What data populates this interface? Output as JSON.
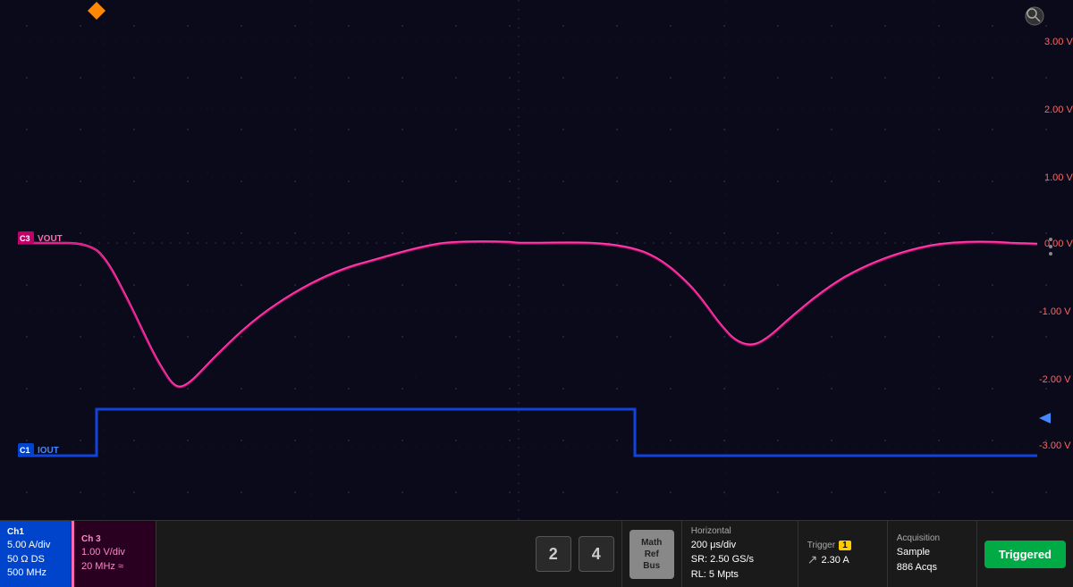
{
  "screen": {
    "y_labels": [
      {
        "value": "3.00 V",
        "pct": 8
      },
      {
        "value": "2.00 V",
        "pct": 21
      },
      {
        "value": "1.00 V",
        "pct": 34
      },
      {
        "value": "0.00 V",
        "pct": 47
      },
      {
        "value": "-1.00 V",
        "pct": 60
      },
      {
        "value": "-2.00 V",
        "pct": 73
      },
      {
        "value": "-3.00 V",
        "pct": 87
      }
    ],
    "ch3_label": "VOUT",
    "ch1_label": "IOUT",
    "trigger_badge": "T"
  },
  "toolbar": {
    "ch1": {
      "label": "Ch1",
      "line1": "5.00 A/div",
      "line2": "50 Ω  DS",
      "line3": "500 MHz"
    },
    "ch3": {
      "label": "Ch 3",
      "line1": "1.00 V/div",
      "line2": "20 MHz ≈"
    },
    "btn2_label": "2",
    "btn4_label": "4",
    "math_ref_bus": "Math\nRef\nBus",
    "horizontal": {
      "label": "Horizontal",
      "line1": "200 μs/div",
      "line2": "SR: 2.50 GS/s",
      "line3": "RL: 5 Mpts"
    },
    "trigger": {
      "label": "Trigger",
      "num": "1",
      "line1": "2.30 A"
    },
    "acquisition": {
      "label": "Acquisition",
      "line1": "Sample",
      "line2": "886 Acqs"
    },
    "triggered_label": "Triggered"
  }
}
